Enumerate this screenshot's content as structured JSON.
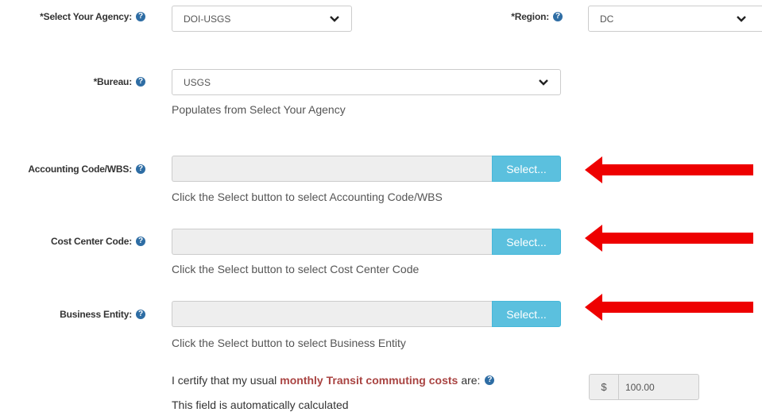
{
  "agency": {
    "label": "*Select Your Agency:",
    "value": "DOI-USGS"
  },
  "region": {
    "label": "*Region:",
    "value": "DC"
  },
  "bureau": {
    "label": "*Bureau:",
    "value": "USGS",
    "help": "Populates from Select Your Agency"
  },
  "accounting": {
    "label": "Accounting Code/WBS:",
    "button": "Select...",
    "help": "Click the Select button to select Accounting Code/WBS"
  },
  "cost_center": {
    "label": "Cost Center Code:",
    "button": "Select...",
    "help": "Click the Select button to select Cost Center Code"
  },
  "business_entity": {
    "label": "Business Entity:",
    "button": "Select...",
    "help": "Click the Select button to select Business Entity"
  },
  "certify": {
    "prefix": "I certify that my usual",
    "highlight": "monthly Transit commuting costs",
    "suffix": "are:",
    "note": "This field is automatically calculated",
    "currency": "$",
    "amount": "100.00"
  },
  "help_icon_glyph": "?",
  "colors": {
    "select_button": "#5bc0de",
    "help_icon": "#2e6da4",
    "highlight": "#a94442",
    "arrow": "#ee0000"
  }
}
